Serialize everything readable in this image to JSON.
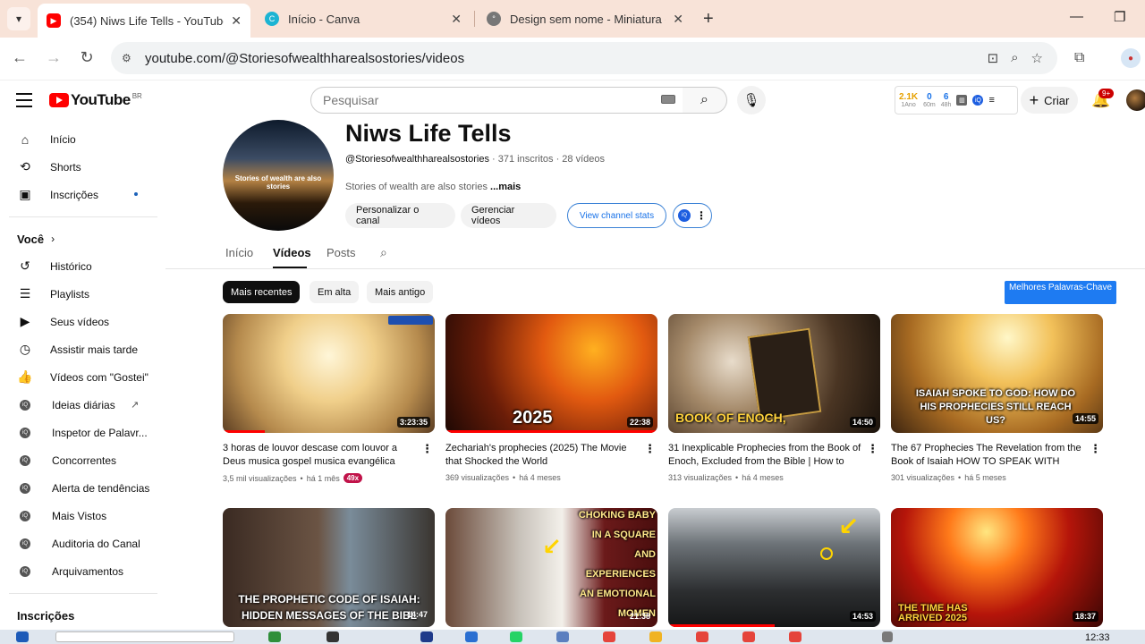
{
  "browser": {
    "tabs": [
      {
        "title": "(354) Niws Life Tells - YouTube",
        "favicon": "youtube-icon",
        "active": true
      },
      {
        "title": "Início - Canva",
        "favicon": "canva-icon",
        "active": false
      },
      {
        "title": "Design sem nome - Miniatura d",
        "favicon": "canva-design-icon",
        "active": false
      }
    ],
    "close_glyph": "✕",
    "url": "youtube.com/@Storiesofwealthharealsostories/videos"
  },
  "yt": {
    "logo_text": "YouTube",
    "country_code": "BR",
    "search_placeholder": "Pesquisar",
    "stats": [
      {
        "value": "2.1K",
        "label": "1Ano",
        "color": "#e6a100"
      },
      {
        "value": "0",
        "label": "60m",
        "color": "#1a73e8"
      },
      {
        "value": "6",
        "label": "48h",
        "color": "#1a73e8"
      }
    ],
    "create_label": "Criar",
    "notif_badge": "9+"
  },
  "sidebar": {
    "main": [
      {
        "label": "Início",
        "icon": "home-icon"
      },
      {
        "label": "Shorts",
        "icon": "shorts-icon"
      },
      {
        "label": "Inscrições",
        "icon": "subscriptions-icon"
      }
    ],
    "you_heading": "Você",
    "you": [
      {
        "label": "Histórico",
        "icon": "history-icon"
      },
      {
        "label": "Playlists",
        "icon": "playlists-icon"
      },
      {
        "label": "Seus vídeos",
        "icon": "your-videos-icon"
      },
      {
        "label": "Assistir mais tarde",
        "icon": "watch-later-icon"
      },
      {
        "label": "Vídeos com \"Gostei\"",
        "icon": "liked-icon"
      }
    ],
    "tools": [
      {
        "label": "Ideias diárias"
      },
      {
        "label": "Inspetor de Palavr..."
      },
      {
        "label": "Concorrentes"
      },
      {
        "label": "Alerta de tendências"
      },
      {
        "label": "Mais Vistos"
      },
      {
        "label": "Auditoria do Canal"
      },
      {
        "label": "Arquivamentos"
      }
    ],
    "subs_heading": "Inscrições"
  },
  "channel": {
    "name": "Niws Life Tells",
    "handle": "@Storiesofwealthharealsostories",
    "subscribers": "371 inscritos",
    "videos_count": "28 vídeos",
    "description": "Stories of wealth are also stories",
    "more": "...mais",
    "avatar_text": "Stories of wealth are also stories",
    "btn_customize": "Personalizar o canal",
    "btn_manage": "Gerenciar vídeos",
    "btn_stats": "View channel stats",
    "tabs": [
      "Início",
      "Vídeos",
      "Posts"
    ],
    "chips": [
      "Mais recentes",
      "Em alta",
      "Mais antigo"
    ],
    "keywords_btn": "Melhores Palavras-Chave"
  },
  "videos": [
    {
      "title": "3 horas de louvor descase com louvor a Deus musica gospel musica evangélica par...",
      "views": "3,5 mil visualizações",
      "age": "há 1 mês",
      "duration": "3:23:35",
      "badge": "49x",
      "overlay": "",
      "progress": 0.2
    },
    {
      "title": "Zechariah's prophecies (2025) The Movie that Shocked the World",
      "views": "369 visualizações",
      "age": "há 4 meses",
      "duration": "22:38",
      "overlay": "2025",
      "progress": 1.0
    },
    {
      "title": "31 Inexplicable Prophecies from the Book of Enoch, Excluded from the Bible | How to Tal...",
      "views": "313 visualizações",
      "age": "há 4 meses",
      "duration": "14:50",
      "overlay": "BOOK OF ENOCH,",
      "progress": 0
    },
    {
      "title": "The 67 Prophecies The Revelation from the Book of Isaiah HOW TO SPEAK WITH GOD...",
      "views": "301 visualizações",
      "age": "há 5 meses",
      "duration": "14:55",
      "overlay": "ISAIAH SPOKE TO GOD: HOW DO HIS PROPHECIES STILL REACH US?",
      "progress": 0
    },
    {
      "title": "",
      "duration": "14:47",
      "overlay": "THE PROPHETIC CODE OF ISAIAH: HIDDEN MESSAGES OF THE BIBL",
      "progress": 0
    },
    {
      "title": "",
      "duration": "21:38",
      "overlay": "\"POPE FRANCIS SAVES A CHOKING BABY IN A SQUARE AND EXPERIENCES AN EMOTIONAL MOMEN",
      "progress": 0
    },
    {
      "title": "",
      "duration": "14:53",
      "overlay": "",
      "progress": 0.5
    },
    {
      "title": "",
      "duration": "18:37",
      "overlay": "THE TIME HAS ARRIVED 2025",
      "progress": 0
    }
  ],
  "taskbar": {
    "time": "12:33"
  }
}
